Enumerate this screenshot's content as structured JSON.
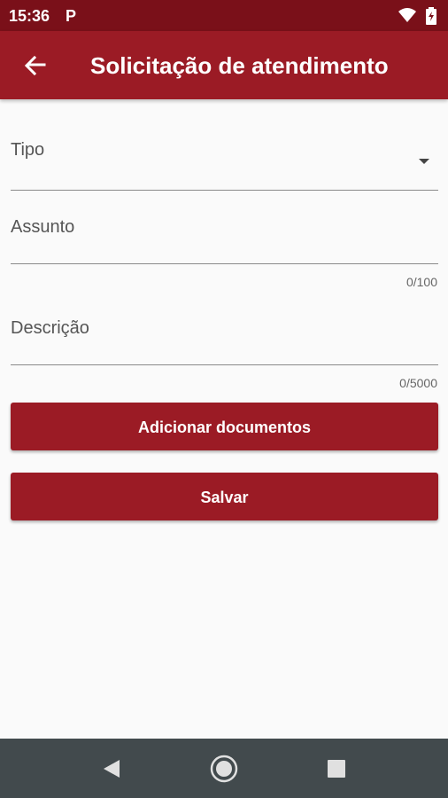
{
  "status_bar": {
    "time": "15:36",
    "notification_letter": "P"
  },
  "app_bar": {
    "title": "Solicitação de atendimento"
  },
  "form": {
    "tipo": {
      "label": "Tipo"
    },
    "assunto": {
      "label": "Assunto",
      "counter": "0/100"
    },
    "descricao": {
      "label": "Descrição",
      "counter": "0/5000"
    }
  },
  "buttons": {
    "add_documents": "Adicionar documentos",
    "save": "Salvar"
  },
  "colors": {
    "primary": "#9b1b25",
    "status_bar": "#7a1019",
    "nav_bar": "#424a4d"
  },
  "icons": {
    "back": "arrow-left-icon",
    "wifi": "wifi-icon",
    "battery": "battery-charging-icon",
    "dropdown": "dropdown-arrow-icon"
  }
}
